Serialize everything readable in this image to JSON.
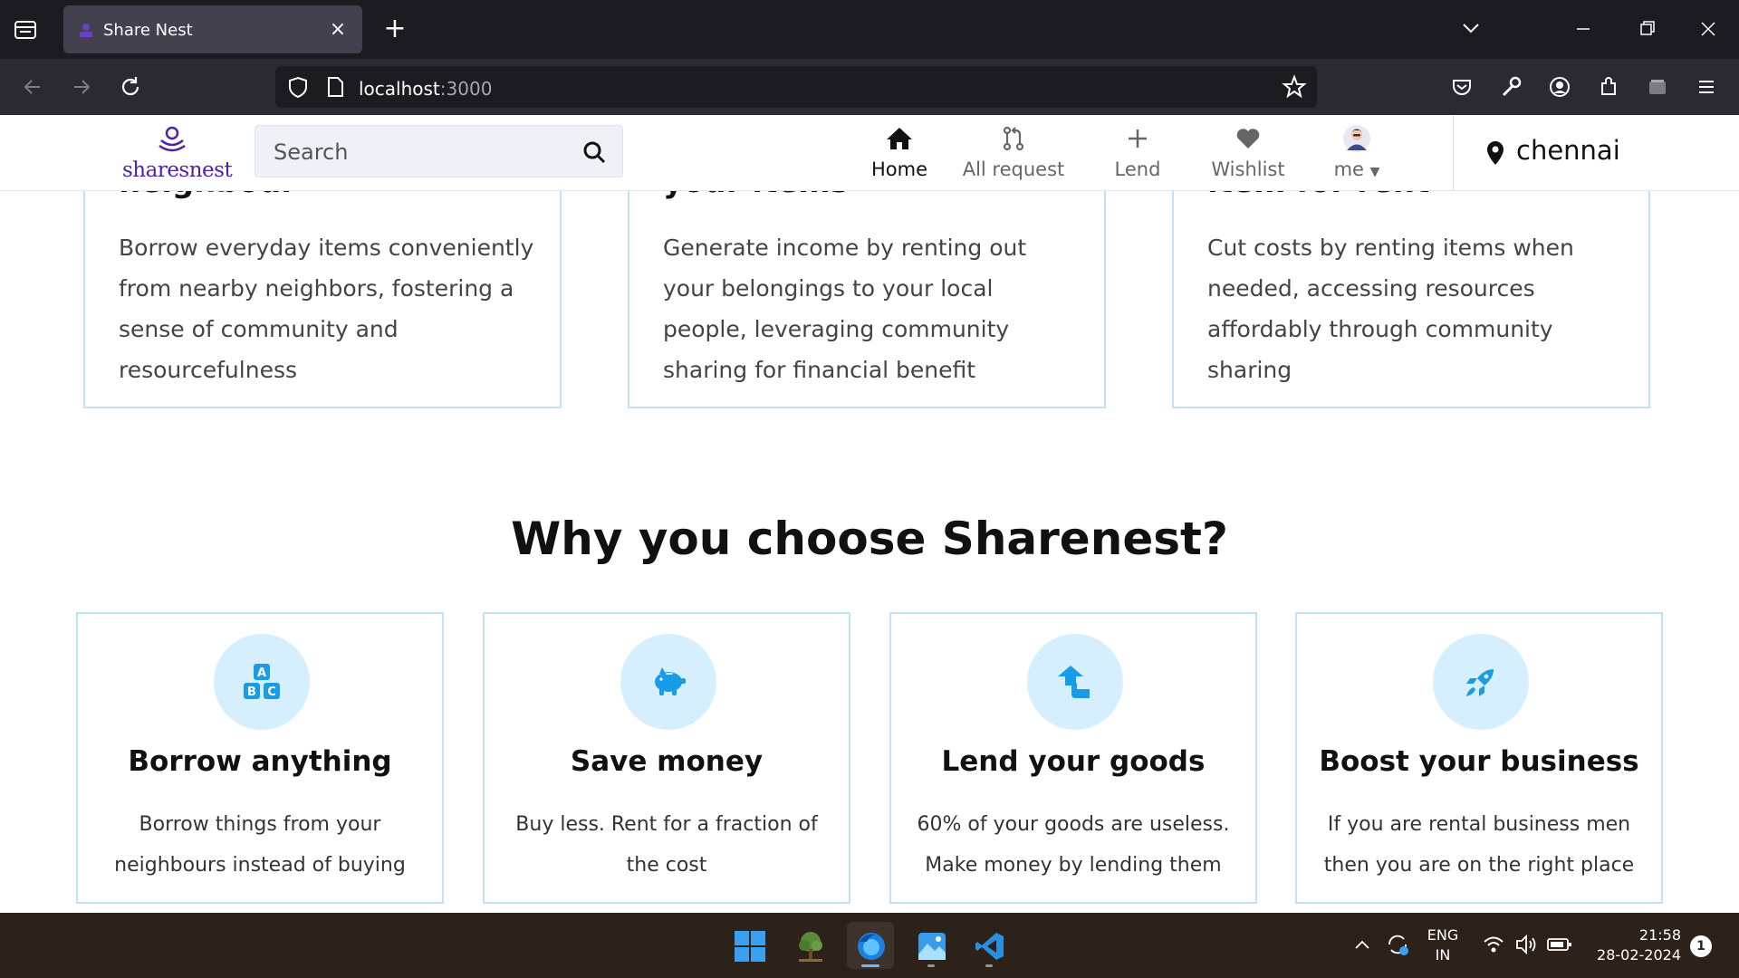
{
  "browser": {
    "tab_title": "Share Nest",
    "url_host": "localhost",
    "url_port": ":3000"
  },
  "site": {
    "logo_text": "sharesnest",
    "search_placeholder": "Search",
    "nav": [
      {
        "label": "Home",
        "icon": "home-icon"
      },
      {
        "label": "All request",
        "icon": "pull-request-icon"
      },
      {
        "label": "Lend",
        "icon": "plus-icon"
      },
      {
        "label": "Wishlist",
        "icon": "heart-icon"
      },
      {
        "label": "me",
        "icon": "avatar"
      }
    ],
    "location": "chennai"
  },
  "top_cards": [
    {
      "title": "neighbour",
      "description": "Borrow everyday items conveniently from nearby neighbors, fostering a sense of community and resourcefulness"
    },
    {
      "title": "your items",
      "description": "Generate income by renting out your belongings to your local people, leveraging community sharing for financial benefit"
    },
    {
      "title": "item for rent",
      "description": "Cut costs by renting items when needed, accessing resources affordably through community sharing"
    }
  ],
  "why_section": {
    "title": "Why you choose Sharenest?",
    "features": [
      {
        "title": "Borrow anything",
        "description": "Borrow things from your neighbours instead of buying",
        "icon": "abc-blocks-icon"
      },
      {
        "title": "Save money",
        "description": "Buy less. Rent for a fraction of the cost",
        "icon": "piggy-bank-icon"
      },
      {
        "title": "Lend your goods",
        "description": "60% of your goods are useless. Make money by lending them",
        "icon": "hand-up-icon"
      },
      {
        "title": "Boost your business",
        "description": "If you are rental business men then you are on the right place",
        "icon": "rocket-icon"
      }
    ]
  },
  "taskbar": {
    "lang_top": "ENG",
    "lang_bottom": "IN",
    "time": "21:58",
    "date": "28-02-2024",
    "notification_count": "1"
  },
  "colors": {
    "brand": "#4b22a8",
    "card_border": "#bfe3f6",
    "icon_circle": "#d6efff",
    "icon_blue": "#1a9be8"
  }
}
